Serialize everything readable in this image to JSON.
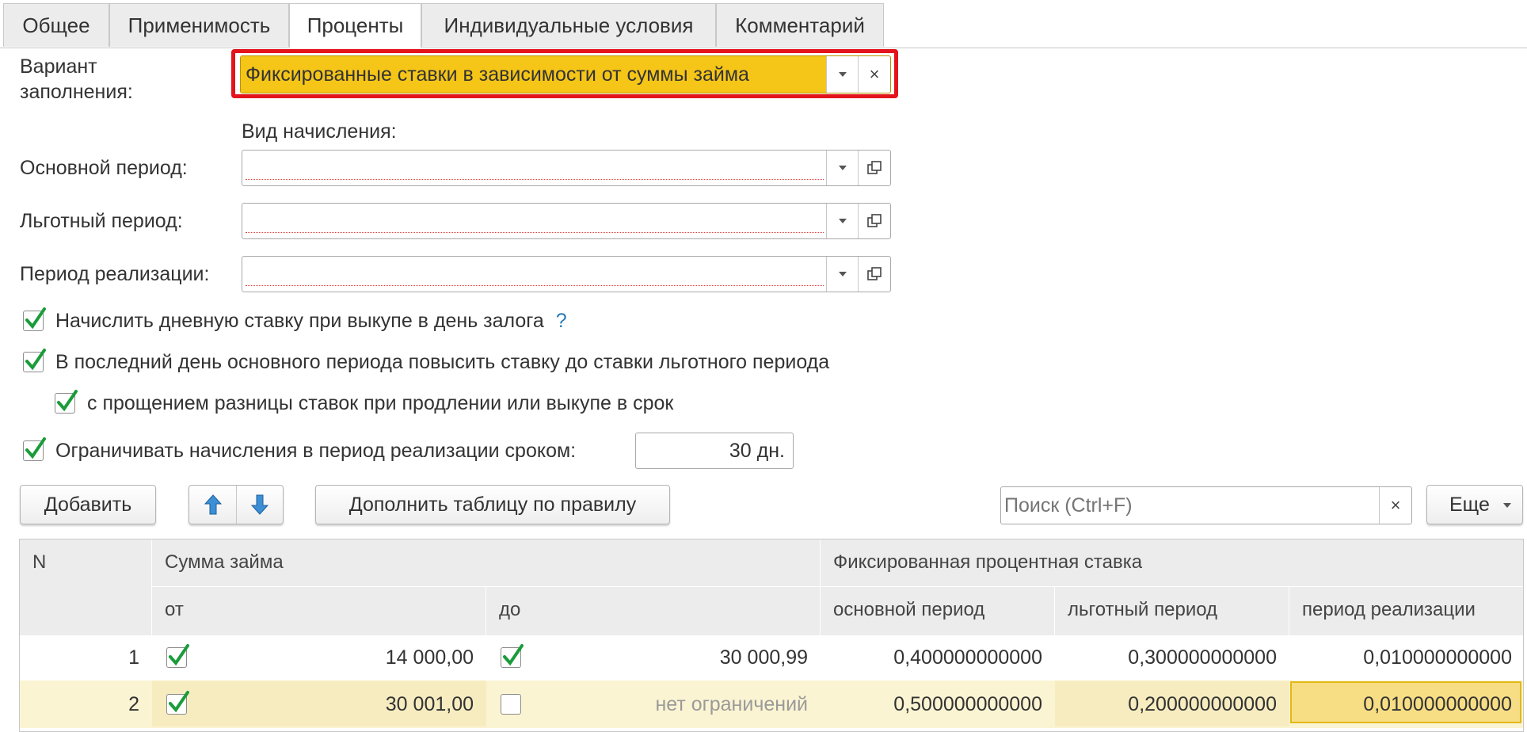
{
  "tabs": [
    {
      "label": "Общее"
    },
    {
      "label": "Применимость"
    },
    {
      "label": "Проценты"
    },
    {
      "label": "Индивидуальные условия"
    },
    {
      "label": "Комментарий"
    }
  ],
  "form": {
    "fill_variant_label": "Вариант\nзаполнения:",
    "fill_variant_value": "Фиксированные ставки в зависимости от суммы займа",
    "accrual_type_label": "Вид начисления:",
    "main_period_label": "Основной период:",
    "main_period_value": "",
    "grace_period_label": "Льготный период:",
    "grace_period_value": "",
    "realization_period_label": "Период реализации:",
    "realization_period_value": ""
  },
  "checks": {
    "daily_rate": {
      "label": "Начислить дневную ставку при выкупе в день залога",
      "checked": true,
      "help": "?"
    },
    "raise_rate": {
      "label": "В последний день основного периода повысить ставку до ставки льготного периода",
      "checked": true
    },
    "forgive_diff": {
      "label": "с прощением разницы ставок при продлении или выкупе в срок",
      "checked": true
    },
    "limit_accrual": {
      "label": "Ограничивать начисления в период реализации сроком:",
      "checked": true,
      "value": "30 дн."
    }
  },
  "toolbar": {
    "add_label": "Добавить",
    "fill_rule_label": "Дополнить таблицу по правилу",
    "search_placeholder": "Поиск (Ctrl+F)",
    "more_label": "Еще"
  },
  "table": {
    "headers": {
      "n": "N",
      "loan_sum": "Сумма займа",
      "fixed_rate": "Фиксированная процентная ставка",
      "from": "от",
      "to": "до",
      "main": "основной период",
      "grace": "льготный период",
      "realization": "период реализации"
    },
    "rows": [
      {
        "n": "1",
        "from_checked": true,
        "from": "14 000,00",
        "to_checked": true,
        "to": "30 000,99",
        "main": "0,400000000000",
        "grace": "0,300000000000",
        "realization": "0,010000000000"
      },
      {
        "n": "2",
        "from_checked": true,
        "from": "30 001,00",
        "to_checked": false,
        "to": "нет ограничений",
        "main": "0,500000000000",
        "grace": "0,200000000000",
        "realization": "0,010000000000"
      }
    ]
  },
  "colors": {
    "highlight_field": "#f5c518",
    "selected_row": "#fbf4d2",
    "active_cell": "#f7de84",
    "red_frame": "#e3141c",
    "check": "#1a9c3a",
    "arrow": "#3b8fd6"
  }
}
